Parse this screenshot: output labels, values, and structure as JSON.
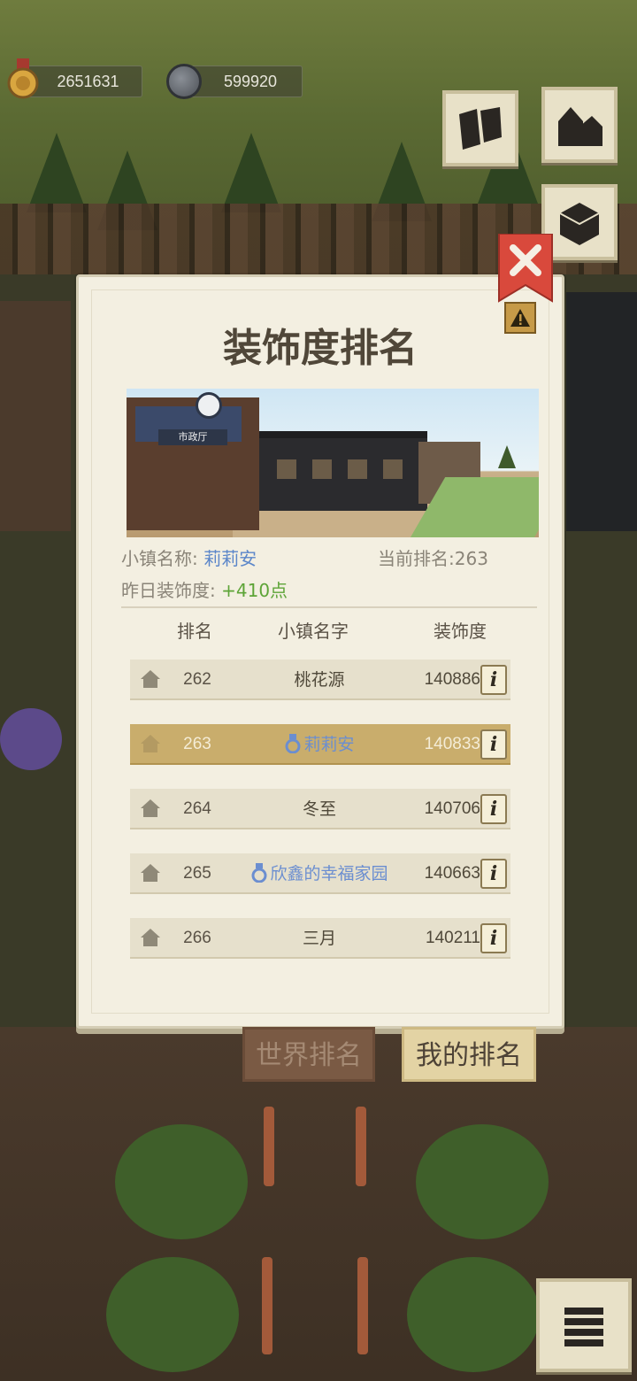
{
  "resources": {
    "medal_count": "2651631",
    "coin_count": "599920"
  },
  "panel": {
    "title": "装饰度排名",
    "banner_sign": "市政厅"
  },
  "town_info": {
    "name_label": "小镇名称:",
    "name_value": "莉莉安",
    "rank_label": "当前排名:",
    "rank_value": "263",
    "deco_label": "昨日装饰度:",
    "deco_value": "+410点"
  },
  "table": {
    "headers": {
      "rank": "排名",
      "name": "小镇名字",
      "score": "装饰度"
    },
    "info_glyph": "i",
    "rows": [
      {
        "rank": "262",
        "name": "桃花源",
        "score": "140886",
        "vip": false,
        "me": false
      },
      {
        "rank": "263",
        "name": "莉莉安",
        "score": "140833",
        "vip": true,
        "me": true
      },
      {
        "rank": "264",
        "name": "冬至",
        "score": "140706",
        "vip": false,
        "me": false
      },
      {
        "rank": "265",
        "name": "欣鑫的幸福家园",
        "score": "140663",
        "vip": true,
        "me": false
      },
      {
        "rank": "266",
        "name": "三月",
        "score": "140211",
        "vip": false,
        "me": false
      }
    ]
  },
  "tabs": {
    "world": "世界排名",
    "mine": "我的排名"
  },
  "colors": {
    "panel_bg": "#f3efe1",
    "highlight_row": "#c9ad6c",
    "vip_name": "#6b8ed0",
    "positive_value": "#5da437",
    "close_ribbon": "#d9493c"
  },
  "icons": {
    "medal": "medal-icon",
    "coin": "coin-icon",
    "tool_1": "map-pieces-icon",
    "tool_2": "buildings-icon",
    "tool_3": "crate-icon",
    "tool_4": "stack-menu-icon",
    "close": "close-icon",
    "warning": "warning-icon",
    "row_house": "house-icon",
    "vip_badge": "vip-badge-icon",
    "info": "info-icon"
  }
}
